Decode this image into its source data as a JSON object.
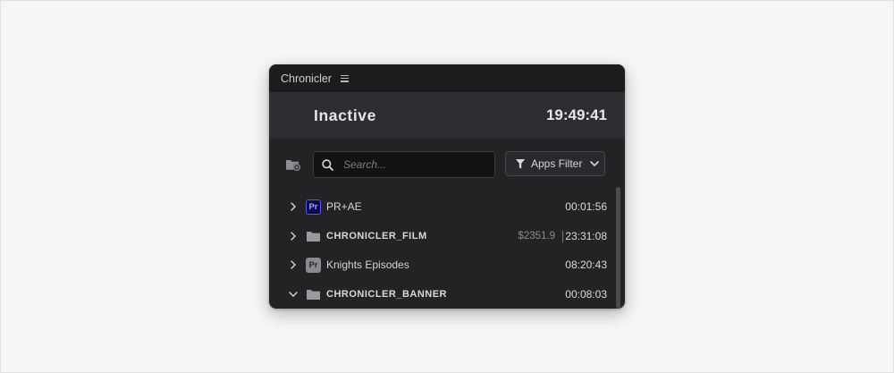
{
  "panel": {
    "title": "Chronicler",
    "menu_icon": "hamburger-menu-icon"
  },
  "status": {
    "state": "Inactive",
    "clock": "19:49:41"
  },
  "toolbar": {
    "add_folder_icon": "add-folder-icon",
    "search_placeholder": "Search...",
    "search_value": "",
    "filter_label": "Apps Filter"
  },
  "list": {
    "items": [
      {
        "name": "PR+AE",
        "type": "project",
        "app_badge": "Pr",
        "badge_color": "#5358ff",
        "expanded": false,
        "time": "00:01:56"
      },
      {
        "name": "CHRONICLER_FILM",
        "type": "folder",
        "expanded": false,
        "earnings": "$2351.9",
        "time": "23:31:08"
      },
      {
        "name": "Knights Episodes",
        "type": "project",
        "app_badge": "Pr",
        "badge_color": "#8a898d",
        "expanded": false,
        "time": "08:20:43"
      },
      {
        "name": "CHRONICLER_BANNER",
        "type": "folder",
        "expanded": true,
        "time": "00:08:03"
      }
    ]
  },
  "colors": {
    "panel_bg": "#232225",
    "titlebar_bg": "#1c1b1e",
    "status_bg": "#2e2d31",
    "premiere_accent": "#5358ff"
  }
}
